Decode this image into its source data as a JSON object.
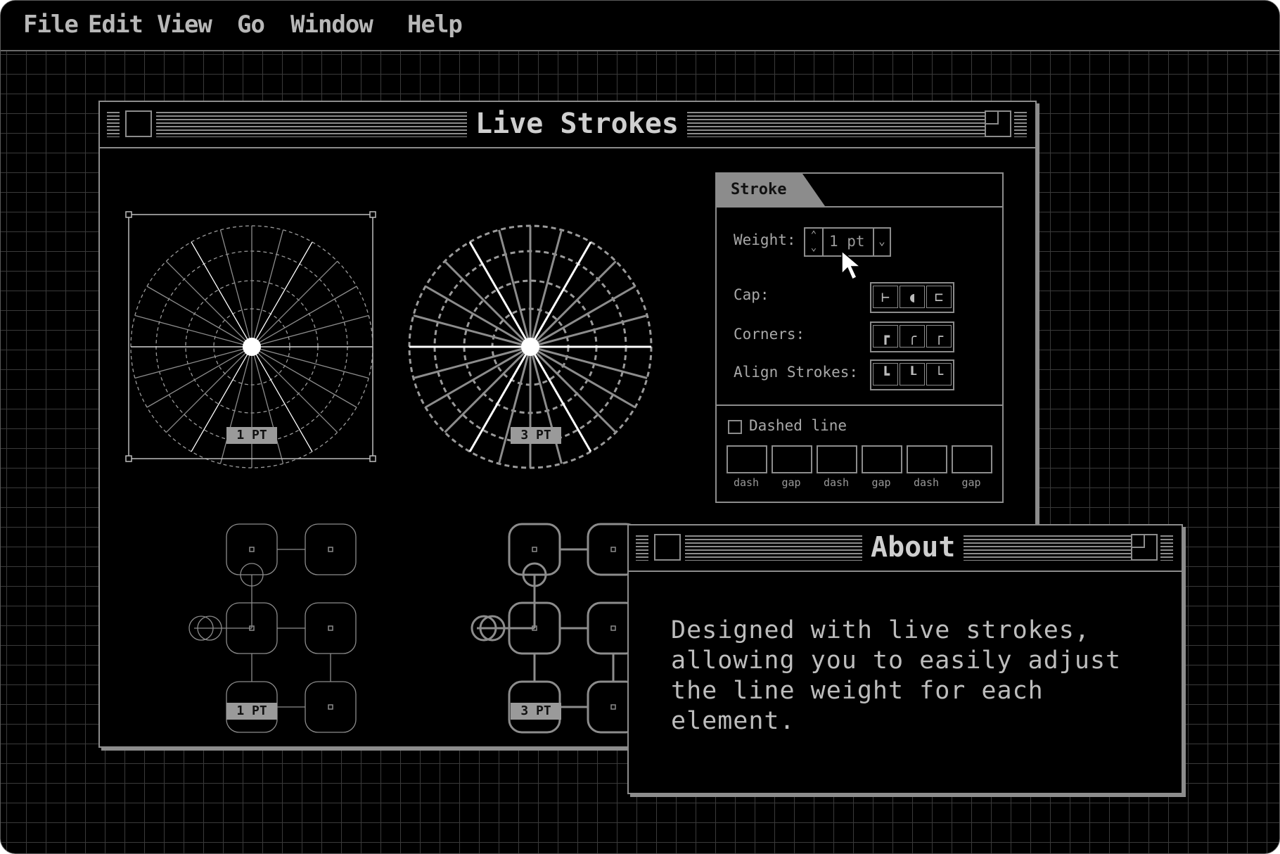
{
  "menu": {
    "file": "File",
    "edit": "Edit",
    "view": "View",
    "go": "Go",
    "window": "Window",
    "help": "Help"
  },
  "live_window": {
    "title": "Live Strokes",
    "labels": [
      "1 PT",
      "3 PT",
      "1 PT",
      "3 PT"
    ]
  },
  "stroke_panel": {
    "tab": "Stroke",
    "weight_label": "Weight:",
    "weight_value": "1 pt",
    "cap_label": "Cap:",
    "corners_label": "Corners:",
    "align_label": "Align Strokes:",
    "dashed_label": "Dashed line",
    "dashed_checked": false,
    "dash_fields": [
      "dash",
      "gap",
      "dash",
      "gap",
      "dash",
      "gap"
    ]
  },
  "about_window": {
    "title": "About",
    "text_lines": [
      "Designed with live strokes,",
      "allowing you to easily adjust",
      "the line weight for each",
      "element."
    ]
  },
  "colors": {
    "background": "#000000",
    "grid": "#3a3a3a",
    "stroke": "#8c8c8c",
    "text": "#bdbdbd"
  }
}
